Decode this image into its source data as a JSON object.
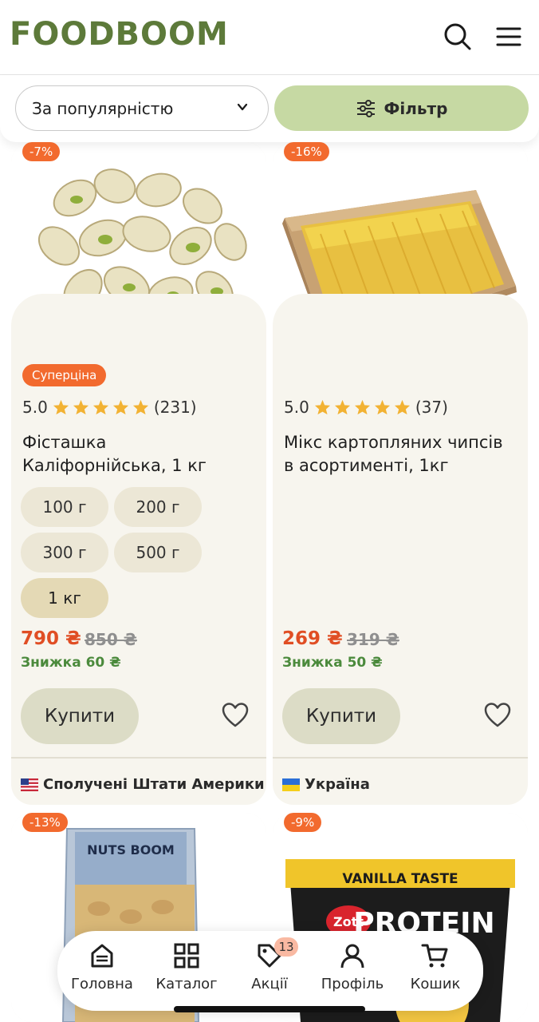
{
  "header": {
    "logo": "FOODBOOM"
  },
  "controls": {
    "sort_label": "За популярністю",
    "filter_label": "Фільтр"
  },
  "products": [
    {
      "discount": "-7%",
      "promo": "Суперціна",
      "rating": "5.0",
      "reviews": "(231)",
      "name_line1": "Фісташка",
      "name_line2": "Каліфорнійська, 1 кг",
      "weights": [
        "100 г",
        "200 г",
        "300 г",
        "500 г",
        "1 кг"
      ],
      "selected_weight": "1 кг",
      "price": "790 ₴",
      "old_price": "850 ₴",
      "saving": "Знижка 60 ₴",
      "buy": "Купити",
      "origin": "Сполучені Штати Америки"
    },
    {
      "discount": "-16%",
      "rating": "5.0",
      "reviews": "(37)",
      "name_line1": "Мікс картопляних чипсів",
      "name_line2": "в асортименті, 1кг",
      "price": "269 ₴",
      "old_price": "319 ₴",
      "saving": "Знижка 50 ₴",
      "buy": "Купити",
      "origin": "Україна"
    },
    {
      "discount": "-13%",
      "package_text": "NUTS BOOM"
    },
    {
      "discount": "-9%",
      "package_text_1": "VANILLA TASTE",
      "package_text_2": "Zott",
      "package_text_3": "PROTEIN"
    }
  ],
  "nav": {
    "items": [
      {
        "label": "Головна"
      },
      {
        "label": "Каталог"
      },
      {
        "label": "Акції",
        "badge": "13"
      },
      {
        "label": "Профіль"
      },
      {
        "label": "Кошик"
      }
    ]
  },
  "colors": {
    "brand": "#5d7a3a",
    "discount": "#f26a2e",
    "price": "#e04e24",
    "saving": "#4b8a3c",
    "filter_bg": "#c6d9a3"
  }
}
